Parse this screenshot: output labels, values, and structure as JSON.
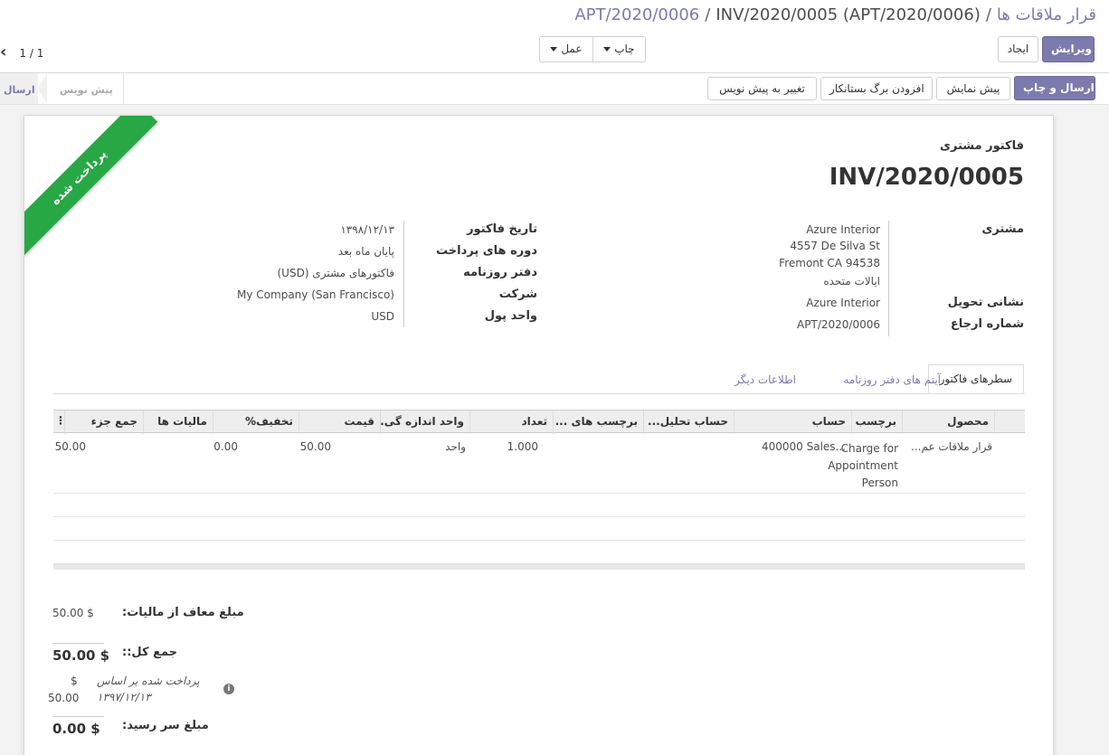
{
  "breadcrumb": {
    "root": "قرار ملاقات ها",
    "parent": "APT/2020/0006",
    "current": "INV/2020/0005 (APT/2020/0006)",
    "separator": "/"
  },
  "toolbar": {
    "edit_label": "ویرایش",
    "create_label": "ایجاد",
    "print_label": "چاپ",
    "action_label": "عمل"
  },
  "pager": {
    "value": "1 / 1"
  },
  "header_buttons": {
    "send_print": "ارسال و چاپ",
    "preview": "پیش نمایش",
    "add_credit_note": "افزودن برگ بستانکار",
    "reset_to_draft": "تغییر به پیش نویس"
  },
  "statusbar": {
    "stages": [
      {
        "label": "پیش نویس",
        "active": false
      },
      {
        "label": "ارسال",
        "active": true
      }
    ]
  },
  "sheet": {
    "ribbon": "پرداخت شده",
    "doc_type": "فاکتور مشتری",
    "doc_number": "INV/2020/0005"
  },
  "customer_group": {
    "customer_label": "مشتری",
    "customer_name": "Azure Interior",
    "address_line1": "4557 De Silva St",
    "address_line2": "Fremont CA 94538",
    "address_line3": "ایالات متحده",
    "delivery_label": "نشانی تحویل",
    "delivery_value": "Azure Interior",
    "reference_label": "شماره ارجاع",
    "reference_value": "APT/2020/0006"
  },
  "invoice_group": {
    "date_label": "تاریخ فاکتور",
    "date_value": "۱۳۹۸/۱۲/۱۳",
    "terms_label": "دوره های پرداخت",
    "terms_value": "پایان ماه بعد",
    "journal_label": "دفتر روزنامه",
    "journal_value": "فاکتورهای مشتری (USD)",
    "company_label": "شرکت",
    "company_value": "My Company (San Francisco)",
    "currency_label": "واحد پول",
    "currency_value": "USD"
  },
  "tabs": [
    {
      "label": "سطرهای فاکتور",
      "active": true
    },
    {
      "label": "آیتم های دفتر روزنامه",
      "active": false
    },
    {
      "label": "اطلاعات دیگر",
      "active": false
    }
  ],
  "table": {
    "columns": [
      "محصول",
      "برچسب",
      "حساب",
      "حساب تحلیل...",
      "برچسب های ...",
      "تعداد",
      "واحد اندازه گی...",
      "قیمت",
      "تخفیف%",
      "مالیات ها",
      "جمع جزء"
    ],
    "column_menu_icon": "⋮",
    "row": {
      "product": "قرار ملاقات عم...",
      "label_l1": "Charge for",
      "label_l2": "Appointment",
      "label_l3": "Person",
      "account": "400000 Sales...",
      "quantity": "1.000",
      "uom": "واحد",
      "price": "50.00",
      "discount": "0.00",
      "subtotal": "50.00"
    }
  },
  "totals": {
    "untaxed_label": "مبلغ معاف از مالیات:",
    "untaxed_value": "50.00 $",
    "total_label": "جمع کل::",
    "total_value": "50.00 $",
    "paid_label": "پرداخت شده بر اساس",
    "paid_date": "۱۳۹۷/۱۲/۱۳",
    "paid_currency": "$",
    "paid_amount": "50.00",
    "residual_label": "مبلغ سر رسید:",
    "residual_value": "0.00 $"
  },
  "colors": {
    "primary": "#7c7bad",
    "ribbon": "#28a745"
  },
  "icons": {
    "pager_prev": "‹",
    "info": "i"
  }
}
